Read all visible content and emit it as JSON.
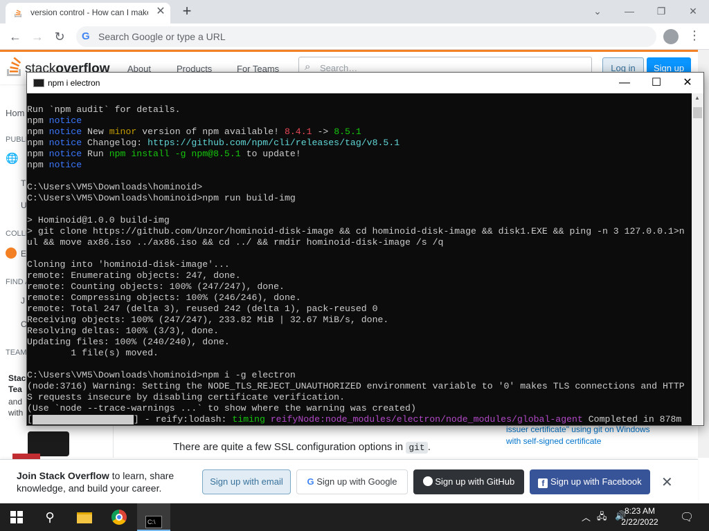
{
  "browser": {
    "tab_title": "version control - How can I make",
    "tab_close": "✕",
    "new_tab": "+",
    "minimize": "⌄",
    "restore": "❐",
    "close": "✕",
    "omnibox_placeholder": "Search Google or type a URL"
  },
  "stackoverflow": {
    "logo_light": "stack",
    "logo_bold": "overflow",
    "nav": [
      "About",
      "Products",
      "For Teams"
    ],
    "search_placeholder": "Search…",
    "login": "Log in",
    "signup": "Sign up",
    "left_fragments": [
      "Hom",
      "PUBLI",
      "T",
      "U",
      "COLLE",
      "E",
      "FIND A",
      "J",
      "C",
      "TEAMS",
      "Stac",
      "Tea",
      "and",
      "with"
    ],
    "content_text_pre": "There are quite a few SSL configuration options in ",
    "content_code": "git",
    "content_text_post": ".",
    "side_links": [
      "issuer certificate\" using git on Windows",
      "with self-signed certificate"
    ]
  },
  "join_banner": {
    "text_bold": "Join Stack Overflow",
    "text_rest": " to learn, share knowledge, and build your career.",
    "btn_email": "Sign up with email",
    "btn_google": "Sign up with Google",
    "btn_github": "Sign up with GitHub",
    "btn_facebook": "Sign up with Facebook",
    "close": "✕"
  },
  "cmd": {
    "title": "npm i electron",
    "minimize": "—",
    "maximize": "☐",
    "close": "✕",
    "lines": [
      [
        {
          "t": "Run `npm audit` for details.",
          "c": "default"
        }
      ],
      [
        {
          "t": "npm ",
          "c": "default"
        },
        {
          "t": "notice",
          "c": "blue"
        }
      ],
      [
        {
          "t": "npm ",
          "c": "default"
        },
        {
          "t": "notice",
          "c": "blue"
        },
        {
          "t": " New ",
          "c": "default"
        },
        {
          "t": "minor",
          "c": "yellow"
        },
        {
          "t": " version of npm available! ",
          "c": "default"
        },
        {
          "t": "8.4.1",
          "c": "red"
        },
        {
          "t": " -> ",
          "c": "default"
        },
        {
          "t": "8.5.1",
          "c": "green"
        }
      ],
      [
        {
          "t": "npm ",
          "c": "default"
        },
        {
          "t": "notice",
          "c": "blue"
        },
        {
          "t": " Changelog: ",
          "c": "default"
        },
        {
          "t": "https://github.com/npm/cli/releases/tag/v8.5.1",
          "c": "cyan"
        }
      ],
      [
        {
          "t": "npm ",
          "c": "default"
        },
        {
          "t": "notice",
          "c": "blue"
        },
        {
          "t": " Run ",
          "c": "default"
        },
        {
          "t": "npm install -g npm@8.5.1",
          "c": "green"
        },
        {
          "t": " to update!",
          "c": "default"
        }
      ],
      [
        {
          "t": "npm ",
          "c": "default"
        },
        {
          "t": "notice",
          "c": "blue"
        }
      ],
      [
        {
          "t": "",
          "c": "default"
        }
      ],
      [
        {
          "t": "C:\\Users\\VM5\\Downloads\\hominoid>",
          "c": "default"
        }
      ],
      [
        {
          "t": "C:\\Users\\VM5\\Downloads\\hominoid>npm run build-img",
          "c": "default"
        }
      ],
      [
        {
          "t": "",
          "c": "default"
        }
      ],
      [
        {
          "t": "> Hominoid@1.0.0 build-img",
          "c": "default"
        }
      ],
      [
        {
          "t": "> git clone https://github.com/Unzor/hominoid-disk-image && cd hominoid-disk-image && disk1.EXE && ping -n 3 127.0.0.1>n",
          "c": "default"
        }
      ],
      [
        {
          "t": "ul && move ax86.iso ../ax86.iso && cd ../ && rmdir hominoid-disk-image /s /q",
          "c": "default"
        }
      ],
      [
        {
          "t": "",
          "c": "default"
        }
      ],
      [
        {
          "t": "Cloning into 'hominoid-disk-image'...",
          "c": "default"
        }
      ],
      [
        {
          "t": "remote: Enumerating objects: 247, done.",
          "c": "default"
        }
      ],
      [
        {
          "t": "remote: Counting objects: 100% (247/247), done.",
          "c": "default"
        }
      ],
      [
        {
          "t": "remote: Compressing objects: 100% (246/246), done.",
          "c": "default"
        }
      ],
      [
        {
          "t": "remote: Total 247 (delta 3), reused 242 (delta 1), pack-reused 0",
          "c": "default"
        }
      ],
      [
        {
          "t": "Receiving objects: 100% (247/247), 233.82 MiB | 32.67 MiB/s, done.",
          "c": "default"
        }
      ],
      [
        {
          "t": "Resolving deltas: 100% (3/3), done.",
          "c": "default"
        }
      ],
      [
        {
          "t": "Updating files: 100% (240/240), done.",
          "c": "default"
        }
      ],
      [
        {
          "t": "        1 file(s) moved.",
          "c": "default"
        }
      ],
      [
        {
          "t": "",
          "c": "default"
        }
      ],
      [
        {
          "t": "C:\\Users\\VM5\\Downloads\\hominoid>npm i -g electron",
          "c": "default"
        }
      ],
      [
        {
          "t": "(node:3716) Warning: Setting the NODE_TLS_REJECT_UNAUTHORIZED environment variable to '0' makes TLS connections and HTTP",
          "c": "default"
        }
      ],
      [
        {
          "t": "S requests insecure by disabling certificate verification.",
          "c": "default"
        }
      ],
      [
        {
          "t": "(Use `node --trace-warnings ...` to show where the warning was created)",
          "c": "default"
        }
      ]
    ],
    "progress_line": {
      "open": "[",
      "close": "] - reify:lodash: ",
      "timing": "timing",
      "stage": " reifyNode:node_modules/electron/node_modules/global-agent",
      "done": " Completed in 878m"
    }
  },
  "taskbar": {
    "time": "8:23 AM",
    "date": "2/22/2022"
  },
  "colors": {
    "so_orange": "#f48024",
    "so_blue": "#0a95ff",
    "terminal_bg": "#0c0c0c",
    "taskbar_bg": "#1f1f1f"
  }
}
